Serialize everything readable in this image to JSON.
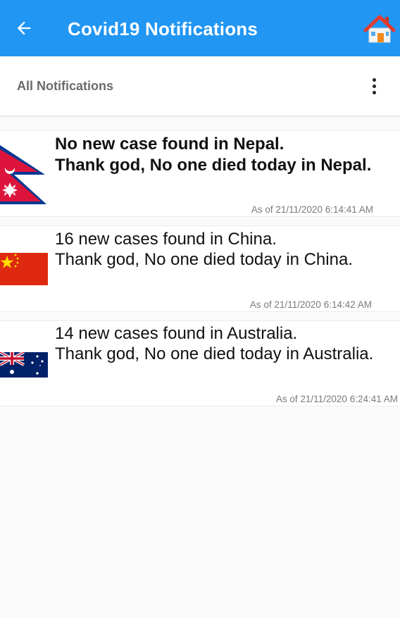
{
  "appbar": {
    "title": "Covid19 Notifications",
    "back_icon": "arrow-left-icon",
    "home_icon": "home-icon",
    "color": "#2196f3"
  },
  "subheader": {
    "title": "All Notifications",
    "menu_icon": "more-vertical-icon"
  },
  "notifications": [
    {
      "country": "Nepal",
      "flag_icon": "nepal-flag-icon",
      "line1": "No new case found in Nepal.",
      "line2": "Thank god, No one died today in Nepal.",
      "timestamp": "As of 21/11/2020 6:14:41 AM"
    },
    {
      "country": "China",
      "flag_icon": "china-flag-icon",
      "line1": "16 new cases found in China.",
      "line2": "Thank god, No one died today in China.",
      "timestamp": "As of 21/11/2020 6:14:42 AM"
    },
    {
      "country": "Australia",
      "flag_icon": "australia-flag-icon",
      "line1": "14 new cases found in Australia.",
      "line2": "Thank god, No one died today in Australia.",
      "timestamp": "As of 21/11/2020 6:24:41 AM"
    }
  ]
}
